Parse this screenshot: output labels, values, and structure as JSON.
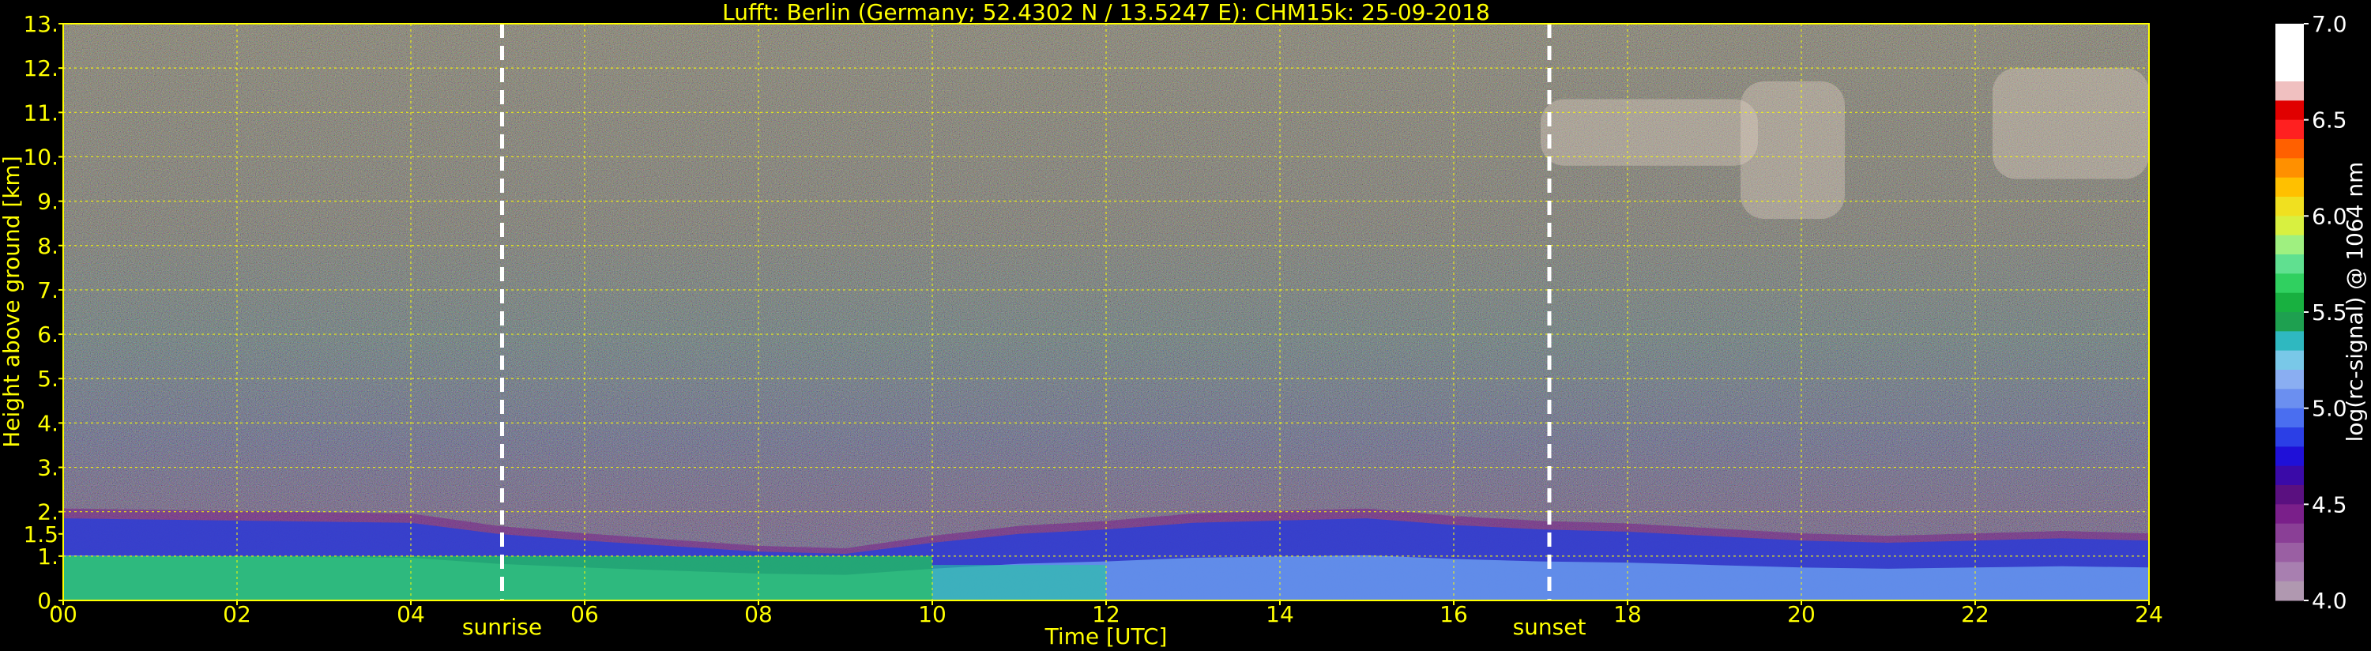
{
  "chart_data": {
    "type": "heatmap",
    "title": "Lufft: Berlin (Germany; 52.4302 N / 13.5247 E):    CHM15k: 25-09-2018",
    "xlabel": "Time [UTC]",
    "ylabel": "Height above ground [km]",
    "xlim": [
      0,
      24
    ],
    "ylim": [
      0,
      13
    ],
    "x_ticks": [
      0,
      2,
      4,
      6,
      8,
      10,
      12,
      14,
      16,
      18,
      20,
      22,
      24
    ],
    "x_tick_labels": [
      "00",
      "02",
      "04",
      "06",
      "08",
      "10",
      "12",
      "14",
      "16",
      "18",
      "20",
      "22",
      "24"
    ],
    "y_ticks": [
      0,
      1,
      2,
      3,
      4,
      5,
      6,
      7,
      8,
      9,
      10,
      11,
      12,
      13
    ],
    "y_tick_labels": [
      "0.",
      "1.",
      "1.5",
      "2.",
      "3.",
      "4.",
      "5.",
      "6.",
      "7.",
      "8.",
      "9.",
      "10.",
      "11.",
      "12.",
      "13."
    ],
    "grid": true,
    "markers": [
      {
        "label": "sunrise",
        "x": 5.05
      },
      {
        "label": "sunset",
        "x": 17.1
      }
    ],
    "colorbar": {
      "label": "log(rc-signal) @ 1064 nm",
      "range": [
        4.0,
        7.0
      ],
      "ticks": [
        4.0,
        4.5,
        5.0,
        5.5,
        6.0,
        6.5,
        7.0
      ],
      "tick_labels": [
        "4.0",
        "4.5",
        "5.0",
        "5.5",
        "6.0",
        "6.5",
        "7.0"
      ]
    },
    "boundary_layer_top_km": [
      [
        0,
        1.85
      ],
      [
        2,
        1.8
      ],
      [
        4,
        1.75
      ],
      [
        5,
        1.5
      ],
      [
        6,
        1.35
      ],
      [
        8,
        1.1
      ],
      [
        9,
        1.05
      ],
      [
        10,
        1.3
      ],
      [
        11,
        1.5
      ],
      [
        12,
        1.6
      ],
      [
        13,
        1.75
      ],
      [
        14,
        1.8
      ],
      [
        15,
        1.85
      ],
      [
        16,
        1.7
      ],
      [
        17,
        1.6
      ],
      [
        18,
        1.55
      ],
      [
        19,
        1.45
      ],
      [
        20,
        1.35
      ],
      [
        21,
        1.3
      ],
      [
        22,
        1.35
      ],
      [
        23,
        1.4
      ],
      [
        24,
        1.35
      ]
    ],
    "cirrus_clouds": [
      {
        "t_start": 17.0,
        "t_end": 19.5,
        "z_low": 9.8,
        "z_high": 11.3
      },
      {
        "t_start": 19.3,
        "t_end": 20.5,
        "z_low": 8.6,
        "z_high": 11.7
      },
      {
        "t_start": 22.2,
        "t_end": 24.0,
        "z_low": 9.5,
        "z_high": 12.0
      }
    ],
    "colors": {
      "title": "#ffff00",
      "axis_text": "#ffff00",
      "background": "#000000"
    }
  }
}
